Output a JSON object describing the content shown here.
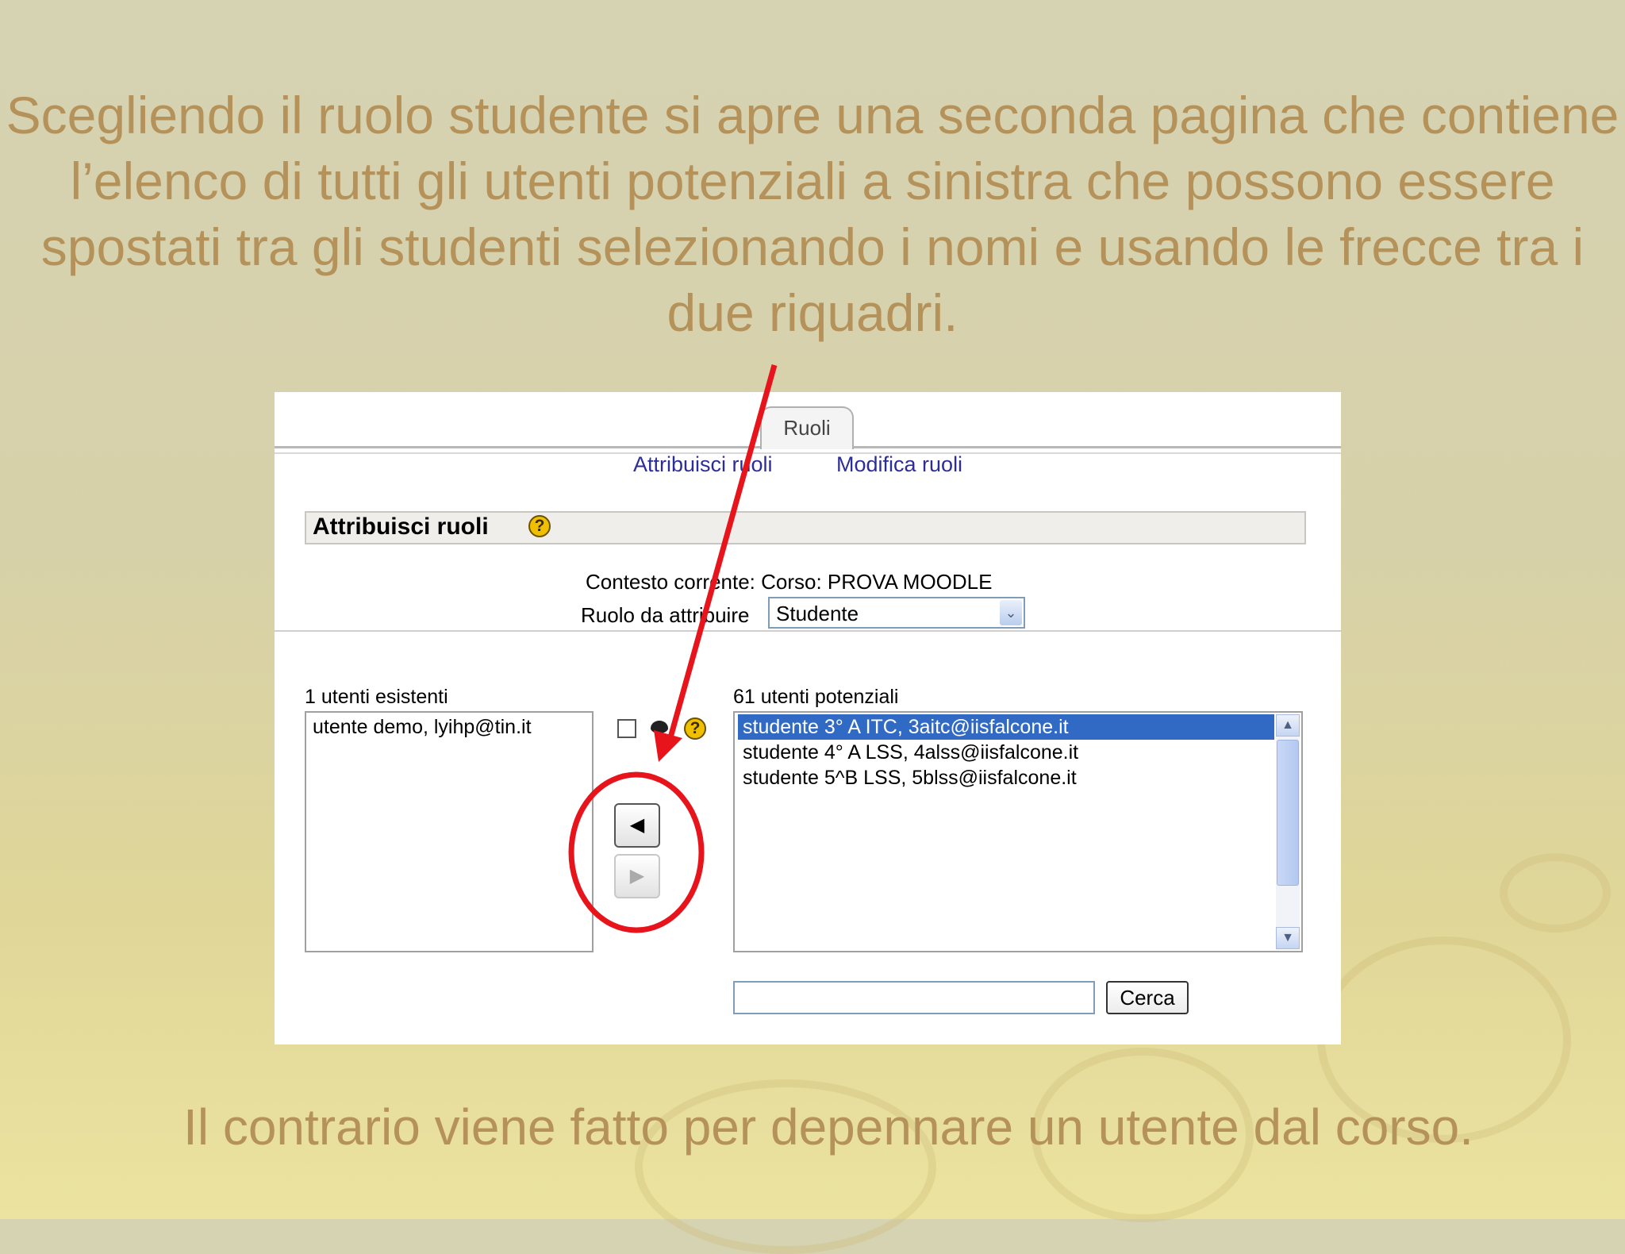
{
  "slide": {
    "title": "Scegliendo il ruolo studente si apre una seconda pagina che contiene l’elenco di tutti gli utenti potenziali a sinistra che possono essere spostati tra gli studenti selezionando i nomi e usando le frecce tra i due riquadri.",
    "footer": "Il contrario viene fatto per depennare un utente dal corso."
  },
  "tabs": {
    "active": "Ruoli"
  },
  "subtabs": {
    "assign": "Attribuisci ruoli",
    "modify": "Modifica ruoli"
  },
  "header": {
    "title": "Attribuisci ruoli",
    "help_glyph": "?"
  },
  "context": {
    "label": "Contesto corrente: Corso: PROVA MOODLE",
    "role_label": "Ruolo da attribuire",
    "role_value": "Studente",
    "role_arrow": "⌄"
  },
  "existing": {
    "label": "1 utenti esistenti",
    "items": [
      "utente demo, lyihp@tin.it"
    ]
  },
  "potential": {
    "label": "61 utenti potenziali",
    "items": [
      "studente 3° A ITC, 3aitc@iisfalcone.it",
      "studente 4° A LSS, 4alss@iisfalcone.it",
      "studente 5^B LSS, 5blss@iisfalcone.it"
    ],
    "selected_index": 0
  },
  "buttons": {
    "add_glyph": "◀",
    "remove_glyph": "▶",
    "search": "Cerca"
  },
  "scrollbar": {
    "up_glyph": "▲",
    "down_glyph": "▼"
  },
  "help_glyph": "?",
  "colors": {
    "slide_text": "#b5925a",
    "annotation": "#e8141c",
    "selection": "#316ac5",
    "link": "#2d2d9a"
  }
}
